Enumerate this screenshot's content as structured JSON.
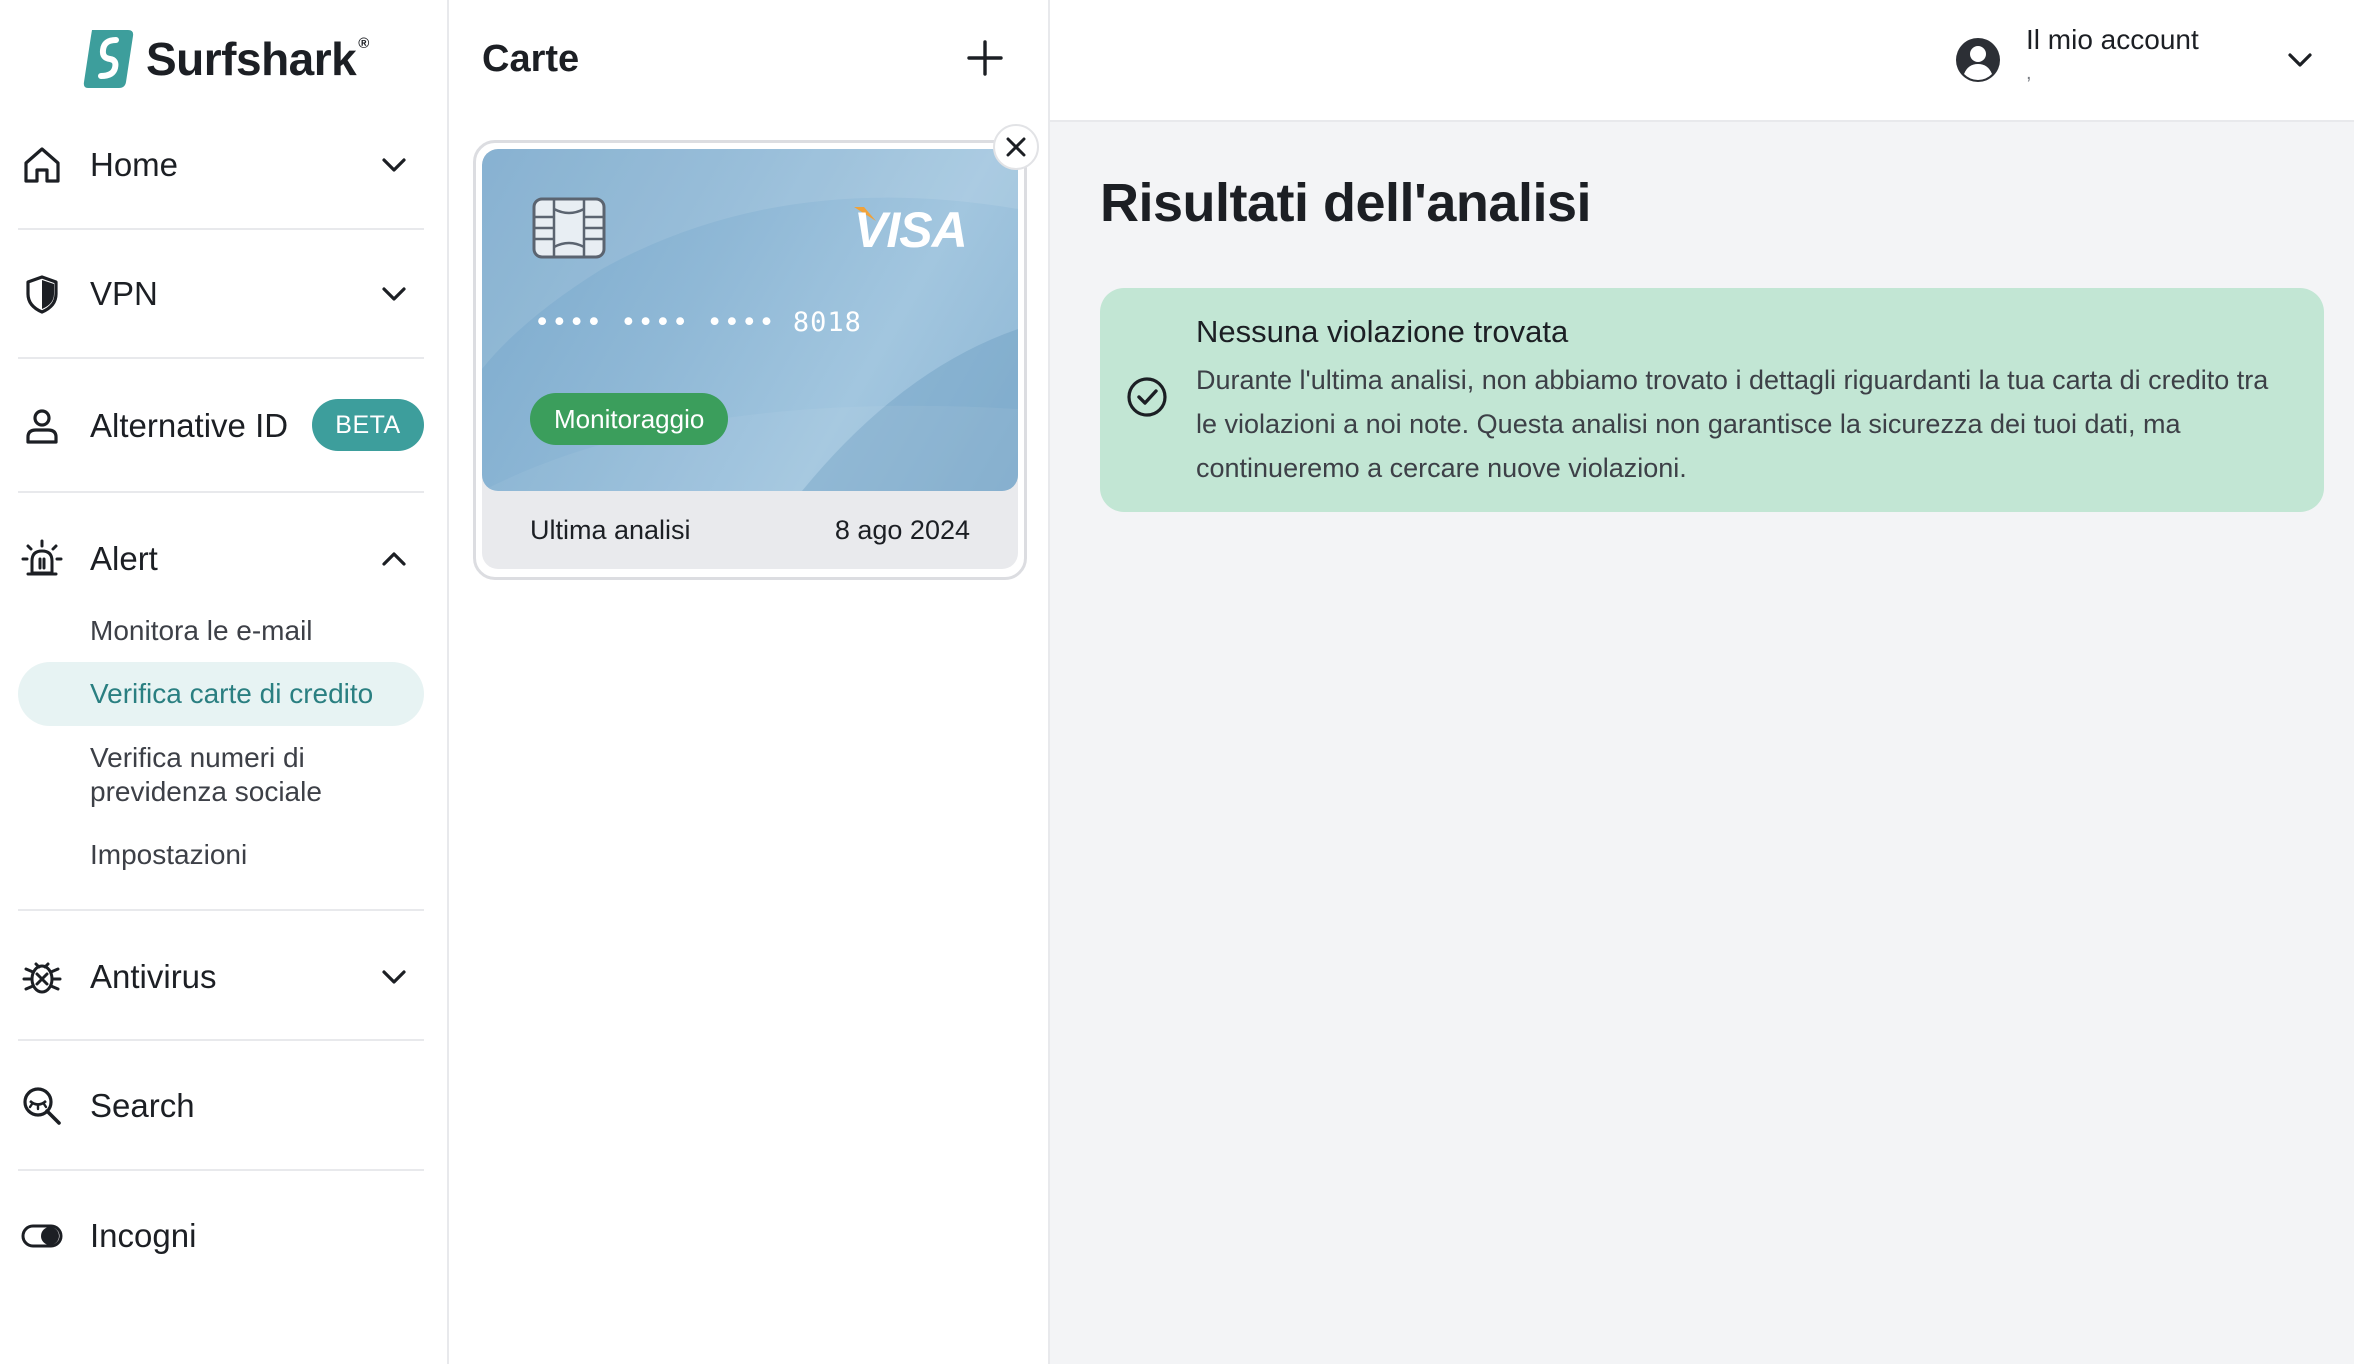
{
  "brand": {
    "name": "Surfshark",
    "reg": "®",
    "color": "#3d9e9c"
  },
  "sidebar": {
    "items": [
      {
        "label": "Home",
        "icon": "home-icon"
      },
      {
        "label": "VPN",
        "icon": "shield-icon"
      },
      {
        "label": "Alternative ID",
        "icon": "person-icon",
        "badge": "BETA"
      },
      {
        "label": "Alert",
        "icon": "alarm-icon",
        "expanded": true,
        "sub_items": [
          {
            "label": "Monitora le e-mail"
          },
          {
            "label": "Verifica carte di credito",
            "active": true
          },
          {
            "label": "Verifica numeri di previdenza sociale"
          },
          {
            "label": "Impostazioni"
          }
        ]
      },
      {
        "label": "Antivirus",
        "icon": "bug-icon"
      },
      {
        "label": "Search",
        "icon": "search-icon"
      },
      {
        "label": "Incogni",
        "icon": "toggle-icon"
      }
    ]
  },
  "cards_panel": {
    "title": "Carte",
    "card": {
      "brand": "VISA",
      "number": "•••• •••• •••• 8018",
      "status": "Monitoraggio",
      "status_color": "#3b9e5c",
      "last_scan_label": "Ultima analisi",
      "last_scan_date": "8 ago 2024"
    }
  },
  "header": {
    "account_label": "Il mio account",
    "account_sub": ","
  },
  "main": {
    "title": "Risultati dell'analisi",
    "result": {
      "heading": "Nessuna violazione trovata",
      "text": "Durante l'ultima analisi, non abbiamo trovato i dettagli riguardanti la tua carta di credito tra le violazioni a noi note. Questa analisi non garantisce la sicurezza dei tuoi dati, ma continueremo a cercare nuove violazioni.",
      "bg_color": "#c2e6d4"
    }
  }
}
